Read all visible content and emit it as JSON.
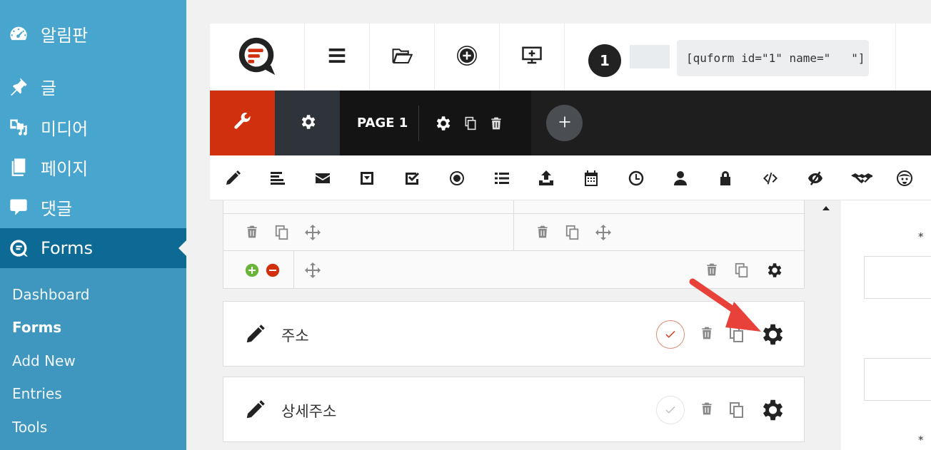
{
  "sidebar": {
    "items": [
      {
        "label": "알림판",
        "icon": "dashboard-icon"
      },
      {
        "label": "글",
        "icon": "pin-icon"
      },
      {
        "label": "미디어",
        "icon": "media-icon"
      },
      {
        "label": "페이지",
        "icon": "pages-icon"
      },
      {
        "label": "댓글",
        "icon": "comments-icon"
      },
      {
        "label": "Forms",
        "icon": "quform-icon",
        "active": true
      }
    ],
    "submenu": [
      "Dashboard",
      "Forms",
      "Add New",
      "Entries",
      "Tools"
    ],
    "submenu_current": "Forms",
    "colors": {
      "bg": "#48a5cd",
      "active_bg": "#0c6a94",
      "submenu_bg": "#3f96be"
    }
  },
  "builder": {
    "toolbar": {
      "icons": [
        "quform-logo-icon",
        "menu-icon",
        "folder-open-icon",
        "add-circle-icon",
        "preview-screen-icon"
      ],
      "form_id": "1",
      "shortcode": "[quform id=\"1\" name=\"   \"]"
    },
    "tabs": {
      "page_label": "PAGE 1",
      "icons": [
        "wrench-icon",
        "gear-icon",
        "page-gear-icon",
        "page-copy-icon",
        "page-trash-icon",
        "add-page-icon"
      ],
      "accent": "#d0300e"
    },
    "field_icons": [
      "pencil-icon",
      "textarea-icon",
      "email-icon",
      "select-icon",
      "checkbox-icon",
      "radio-icon",
      "list-icon",
      "upload-icon",
      "date-icon",
      "time-icon",
      "name-icon",
      "password-icon",
      "html-icon",
      "hidden-icon",
      "captcha-icon",
      "avatar-icon"
    ],
    "fields": [
      {
        "label": "주소",
        "required": true
      },
      {
        "label": "상세주소",
        "required": false
      }
    ],
    "right_panel": {
      "required_mark": "*"
    }
  }
}
